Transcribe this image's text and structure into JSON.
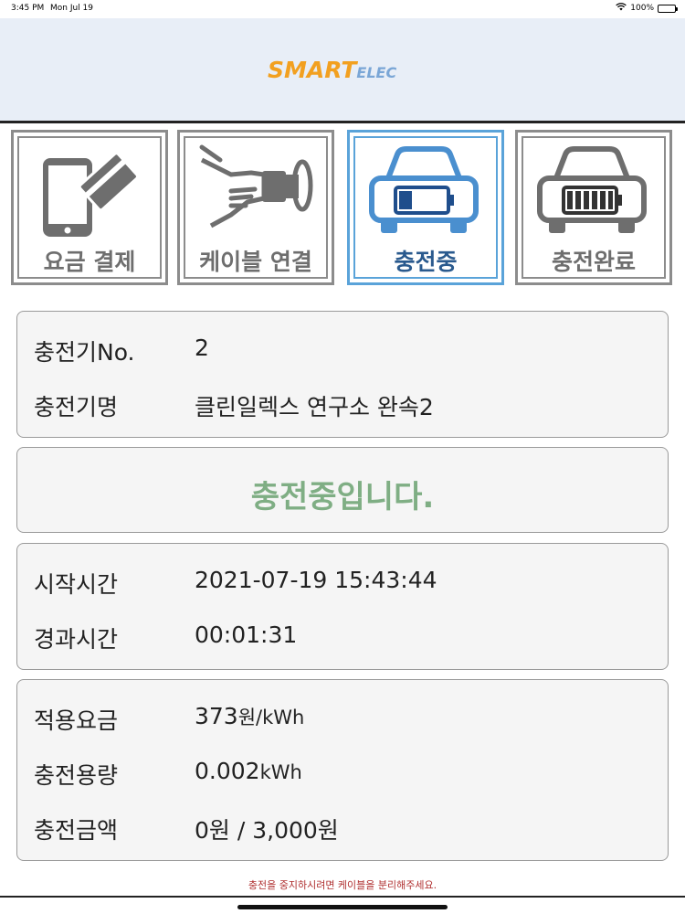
{
  "status_bar": {
    "time": "3:45 PM",
    "date": "Mon Jul 19",
    "battery": "100%"
  },
  "logo": {
    "smart": "SMART",
    "elec": "ELEC"
  },
  "steps": [
    {
      "label": "요금 결제",
      "icon": "phone-card-icon",
      "active": false
    },
    {
      "label": "케이블 연결",
      "icon": "plug-connect-icon",
      "active": false
    },
    {
      "label": "충전중",
      "icon": "car-charging-icon",
      "active": true
    },
    {
      "label": "충전완료",
      "icon": "car-full-battery-icon",
      "active": false
    }
  ],
  "charger_info": {
    "number_label": "충전기No.",
    "number_value": "2",
    "name_label": "충전기명",
    "name_value": "클린일렉스 연구소 완속2"
  },
  "status_message": "충전중입니다.",
  "time_info": {
    "start_label": "시작시간",
    "start_value": "2021-07-19 15:43:44",
    "elapsed_label": "경과시간",
    "elapsed_value": "00:01:31"
  },
  "charge_info": {
    "rate_label": "적용요금",
    "rate_value": "373",
    "rate_unit": "원/kWh",
    "amount_label": "충전용량",
    "amount_value": "0.002",
    "amount_unit": "kWh",
    "cost_label": "충전금액",
    "cost_value": "0원 / 3,000원"
  },
  "footer_note": "충전을 중지하시려면 케이블을 분리해주세요.",
  "colors": {
    "accent_blue": "#5aa3d9",
    "status_green": "#7fae84",
    "warning_red": "#b03030",
    "inactive_gray": "#8c8c8c"
  }
}
